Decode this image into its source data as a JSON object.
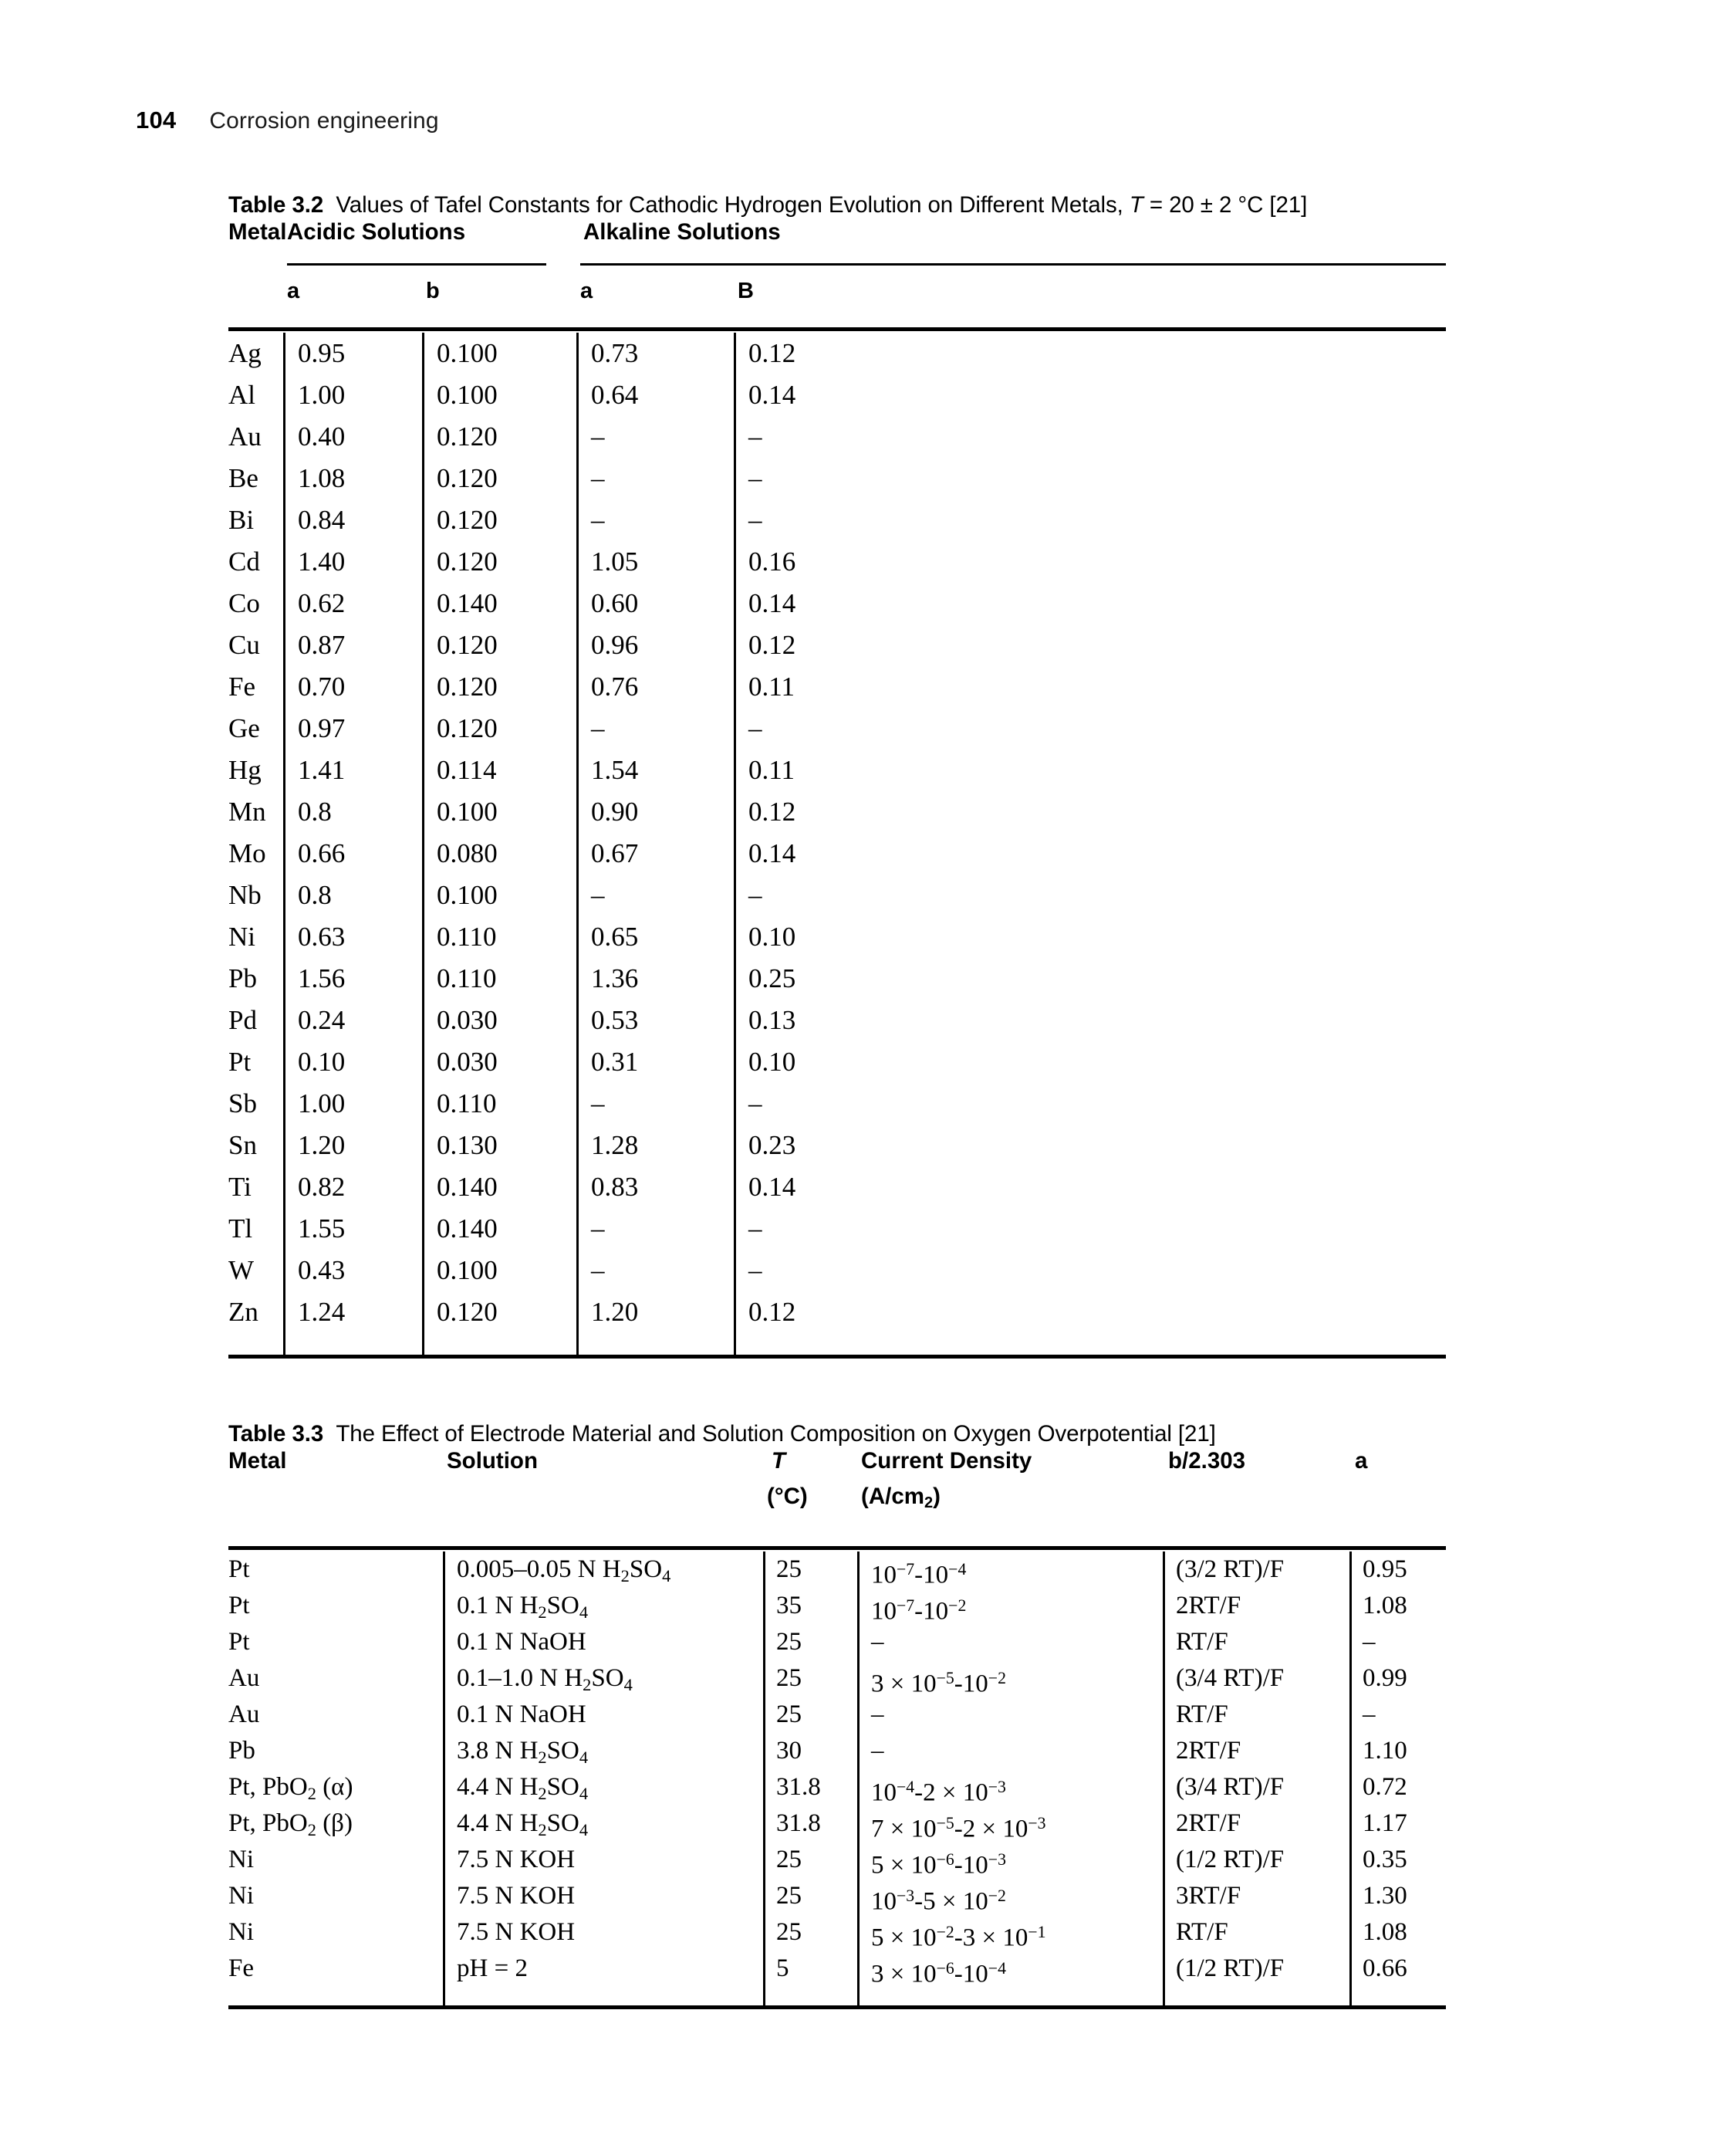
{
  "running_head": {
    "page_number": "104",
    "title": "Corrosion engineering"
  },
  "table_32": {
    "caption_label": "Table 3.2",
    "caption_text_a": "Values of Tafel Constants for Cathodic Hydrogen Evolution on Different Metals, ",
    "caption_italic_T": "T",
    "caption_text_b": " = 20 ± 2 °C [21]",
    "col_metal": "Metal",
    "group_acidic": "Acidic Solutions",
    "group_alkaline": "Alkaline Solutions",
    "sub_acidic_a": "a",
    "sub_acidic_b": "b",
    "sub_alkaline_a": "a",
    "sub_alkaline_b": "B",
    "rows": [
      {
        "metal": "Ag",
        "acid_a": "0.95",
        "acid_b": "0.100",
        "alk_a": "0.73",
        "alk_b": "0.12"
      },
      {
        "metal": "Al",
        "acid_a": "1.00",
        "acid_b": "0.100",
        "alk_a": "0.64",
        "alk_b": "0.14"
      },
      {
        "metal": "Au",
        "acid_a": "0.40",
        "acid_b": "0.120",
        "alk_a": "–",
        "alk_b": "–"
      },
      {
        "metal": "Be",
        "acid_a": "1.08",
        "acid_b": "0.120",
        "alk_a": "–",
        "alk_b": "–"
      },
      {
        "metal": "Bi",
        "acid_a": "0.84",
        "acid_b": "0.120",
        "alk_a": "–",
        "alk_b": "–"
      },
      {
        "metal": "Cd",
        "acid_a": "1.40",
        "acid_b": "0.120",
        "alk_a": "1.05",
        "alk_b": "0.16"
      },
      {
        "metal": "Co",
        "acid_a": "0.62",
        "acid_b": "0.140",
        "alk_a": "0.60",
        "alk_b": "0.14"
      },
      {
        "metal": "Cu",
        "acid_a": "0.87",
        "acid_b": "0.120",
        "alk_a": "0.96",
        "alk_b": "0.12"
      },
      {
        "metal": "Fe",
        "acid_a": "0.70",
        "acid_b": "0.120",
        "alk_a": "0.76",
        "alk_b": "0.11"
      },
      {
        "metal": "Ge",
        "acid_a": "0.97",
        "acid_b": "0.120",
        "alk_a": "–",
        "alk_b": "–"
      },
      {
        "metal": "Hg",
        "acid_a": "1.41",
        "acid_b": "0.114",
        "alk_a": "1.54",
        "alk_b": "0.11"
      },
      {
        "metal": "Mn",
        "acid_a": "0.8",
        "acid_b": "0.100",
        "alk_a": "0.90",
        "alk_b": "0.12"
      },
      {
        "metal": "Mo",
        "acid_a": "0.66",
        "acid_b": "0.080",
        "alk_a": "0.67",
        "alk_b": "0.14"
      },
      {
        "metal": "Nb",
        "acid_a": "0.8",
        "acid_b": "0.100",
        "alk_a": "–",
        "alk_b": "–"
      },
      {
        "metal": "Ni",
        "acid_a": "0.63",
        "acid_b": "0.110",
        "alk_a": "0.65",
        "alk_b": "0.10"
      },
      {
        "metal": "Pb",
        "acid_a": "1.56",
        "acid_b": "0.110",
        "alk_a": "1.36",
        "alk_b": "0.25"
      },
      {
        "metal": "Pd",
        "acid_a": "0.24",
        "acid_b": "0.030",
        "alk_a": "0.53",
        "alk_b": "0.13"
      },
      {
        "metal": "Pt",
        "acid_a": "0.10",
        "acid_b": "0.030",
        "alk_a": "0.31",
        "alk_b": "0.10"
      },
      {
        "metal": "Sb",
        "acid_a": "1.00",
        "acid_b": "0.110",
        "alk_a": "–",
        "alk_b": "–"
      },
      {
        "metal": "Sn",
        "acid_a": "1.20",
        "acid_b": "0.130",
        "alk_a": "1.28",
        "alk_b": "0.23"
      },
      {
        "metal": "Ti",
        "acid_a": "0.82",
        "acid_b": "0.140",
        "alk_a": "0.83",
        "alk_b": "0.14"
      },
      {
        "metal": "Tl",
        "acid_a": "1.55",
        "acid_b": "0.140",
        "alk_a": "–",
        "alk_b": "–"
      },
      {
        "metal": "W",
        "acid_a": "0.43",
        "acid_b": "0.100",
        "alk_a": "–",
        "alk_b": "–"
      },
      {
        "metal": "Zn",
        "acid_a": "1.24",
        "acid_b": "0.120",
        "alk_a": "1.20",
        "alk_b": "0.12"
      }
    ]
  },
  "table_33": {
    "caption_label": "Table 3.3",
    "caption_text": "The Effect of Electrode Material and Solution Composition on Oxygen Overpotential [21]",
    "col_metal": "Metal",
    "col_solution": "Solution",
    "col_T": "T",
    "col_T_unit": "(°C)",
    "col_current_density": "Current Density",
    "col_current_density_unit": "(A/cm2)",
    "col_b2303": "b/2.303",
    "col_a": "a",
    "rows": [
      {
        "metal": "Pt",
        "solution": "0.005–0.05 N H2SO4",
        "T": "25",
        "j": "10−7-10−4",
        "b": "(3/2 RT)/F",
        "a": "0.95"
      },
      {
        "metal": "Pt",
        "solution": "0.1 N H2SO4",
        "T": "35",
        "j": "10−7-10−2",
        "b": "2RT/F",
        "a": "1.08"
      },
      {
        "metal": "Pt",
        "solution": "0.1 N NaOH",
        "T": "25",
        "j": "–",
        "b": "RT/F",
        "a": "–"
      },
      {
        "metal": "Au",
        "solution": "0.1–1.0 N H2SO4",
        "T": "25",
        "j": "3 × 10−5-10−2",
        "b": "(3/4 RT)/F",
        "a": "0.99"
      },
      {
        "metal": "Au",
        "solution": "0.1 N NaOH",
        "T": "25",
        "j": "–",
        "b": "RT/F",
        "a": "–"
      },
      {
        "metal": "Pb",
        "solution": "3.8 N H2SO4",
        "T": "30",
        "j": "–",
        "b": "2RT/F",
        "a": "1.10"
      },
      {
        "metal": "Pt, PbO2 (α)",
        "solution": "4.4 N H2SO4",
        "T": "31.8",
        "j": "10−4-2 × 10−3",
        "b": "(3/4 RT)/F",
        "a": "0.72"
      },
      {
        "metal": "Pt, PbO2 (β)",
        "solution": "4.4 N H2SO4",
        "T": "31.8",
        "j": "7 × 10−5-2 × 10−3",
        "b": "2RT/F",
        "a": "1.17"
      },
      {
        "metal": "Ni",
        "solution": "7.5 N KOH",
        "T": "25",
        "j": "5 × 10−6-10−3",
        "b": "(1/2 RT)/F",
        "a": "0.35"
      },
      {
        "metal": "Ni",
        "solution": "7.5 N KOH",
        "T": "25",
        "j": "10−3-5 × 10−2",
        "b": "3RT/F",
        "a": "1.30"
      },
      {
        "metal": "Ni",
        "solution": "7.5 N KOH",
        "T": "25",
        "j": "5 × 10−2-3 × 10−1",
        "b": "RT/F",
        "a": "1.08"
      },
      {
        "metal": "Fe",
        "solution": "pH = 2",
        "T": "5",
        "j": "3 × 10−6-10−4",
        "b": "(1/2 RT)/F",
        "a": "0.66"
      }
    ]
  }
}
